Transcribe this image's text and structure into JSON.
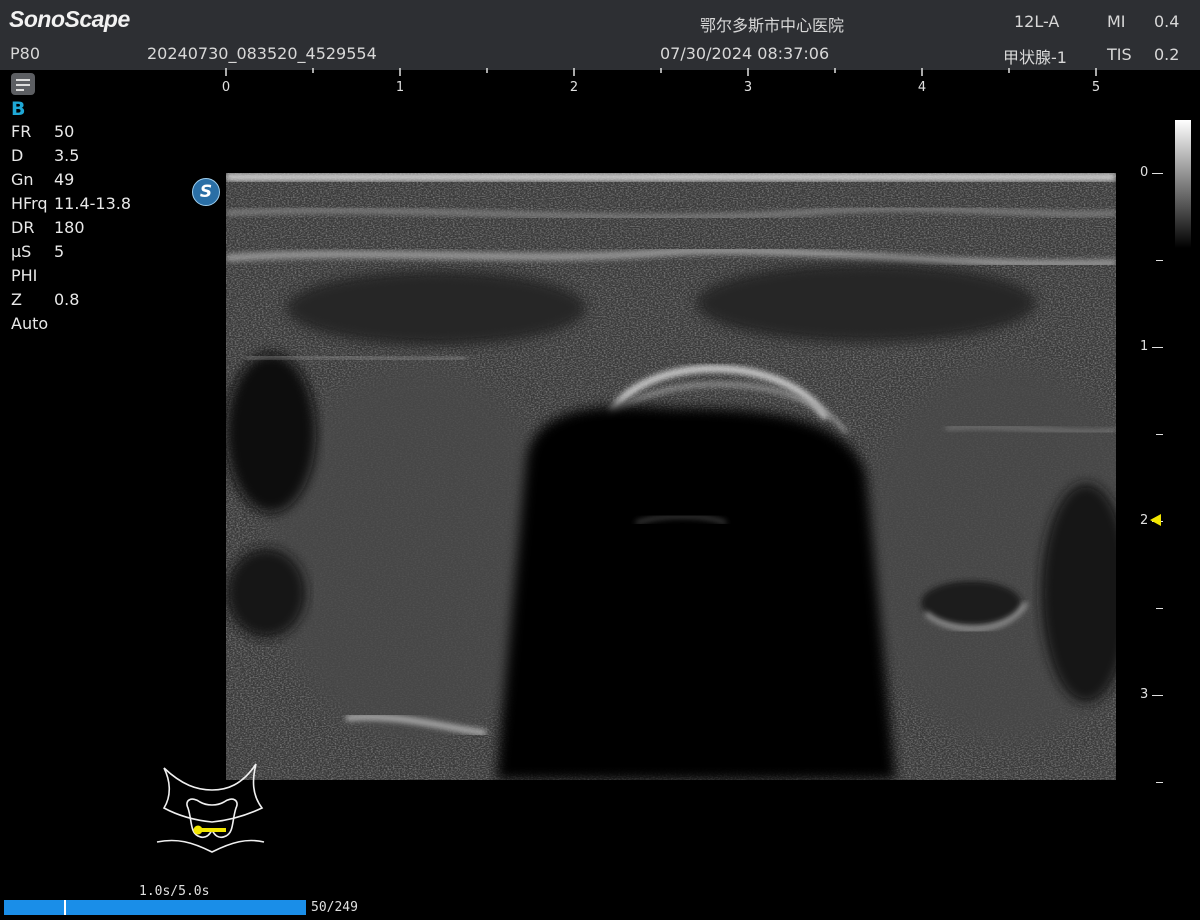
{
  "header": {
    "brand": "SonoScape",
    "hospital": "鄂尔多斯市中心医院",
    "probe": "12L-A",
    "mi_label": "MI",
    "mi_value": "0.4",
    "preset_short": "P80",
    "exam_id": "20240730_083520_4529554",
    "datetime": "07/30/2024 08:37:06",
    "preset": "甲状腺-1",
    "tis_label": "TIS",
    "tis_value": "0.2"
  },
  "sidebar": {
    "menu_icon": "menu-icon",
    "mode": "B",
    "params": [
      {
        "key": "FR",
        "value": "50"
      },
      {
        "key": "D",
        "value": "3.5"
      },
      {
        "key": "Gn",
        "value": "49"
      },
      {
        "key": "HFrq",
        "value": "11.4-13.8"
      },
      {
        "key": "DR",
        "value": "180"
      },
      {
        "key": "μS",
        "value": "5"
      },
      {
        "key": "PHI",
        "value": ""
      },
      {
        "key": "Z",
        "value": "0.8"
      },
      {
        "key": "Auto",
        "value": ""
      }
    ]
  },
  "ruler": {
    "labels": [
      "0",
      "1",
      "2",
      "3",
      "4",
      "5"
    ]
  },
  "depth_scale": {
    "labels": [
      "0",
      "1",
      "2",
      "3"
    ]
  },
  "image": {
    "logo_letter": "S",
    "focus_color": "#f2e600"
  },
  "cine": {
    "time": "1.0s/5.0s",
    "frames": "50/249",
    "position": 0.2,
    "bar_color": "#1a8ee8"
  },
  "bodymark": {
    "icon": "thyroid-bodymark-icon",
    "probe_color": "#f2e600"
  }
}
